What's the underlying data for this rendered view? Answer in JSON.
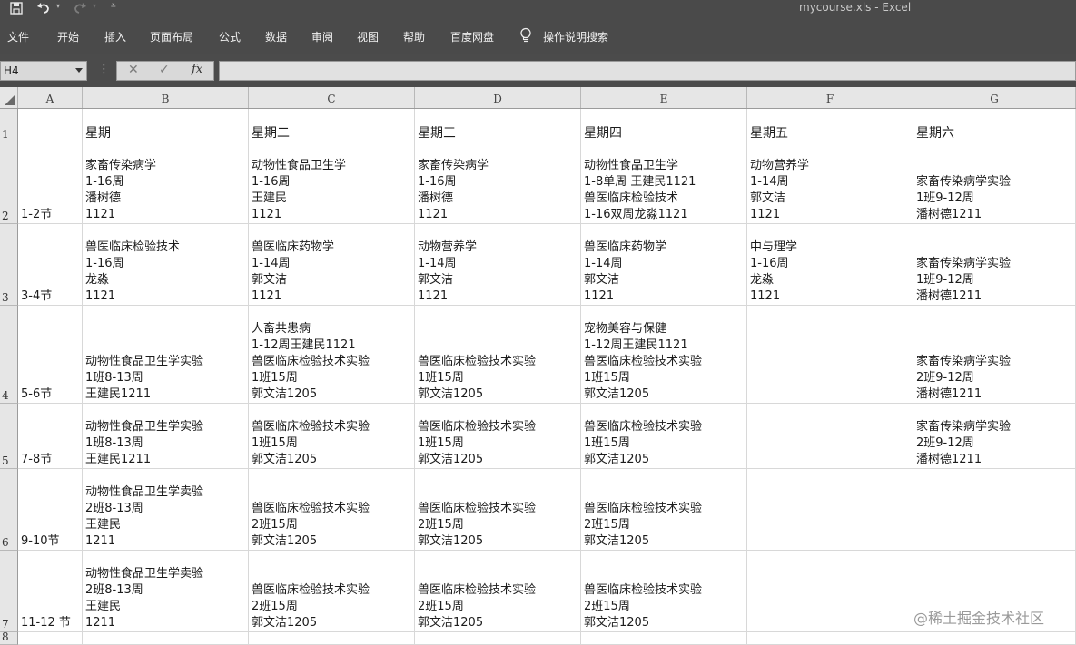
{
  "window": {
    "title": "mycourse.xls  -  Excel"
  },
  "quick_access": {
    "save_icon": "save-icon",
    "undo_icon": "undo-icon",
    "redo_icon": "redo-icon",
    "customize_icon": "customize-qat-icon"
  },
  "ribbon": {
    "tabs": [
      "文件",
      "开始",
      "插入",
      "页面布局",
      "公式",
      "数据",
      "审阅",
      "视图",
      "帮助",
      "百度网盘"
    ],
    "tell_me": "操作说明搜索",
    "tell_me_icon": "lightbulb-icon"
  },
  "formula_bar": {
    "name_box": "H4",
    "cancel_glyph": "✕",
    "enter_glyph": "✓",
    "fx_glyph": "fx",
    "formula": ""
  },
  "sheet": {
    "columns": [
      "A",
      "B",
      "C",
      "D",
      "E",
      "F",
      "G"
    ],
    "rows": [
      {
        "num": "1",
        "cells": [
          "",
          "星期",
          "星期二",
          "星期三",
          "星期四",
          "星期五",
          "星期六"
        ]
      },
      {
        "num": "2",
        "cells": [
          "1-2节",
          "家畜传染病学\n1-16周\n潘树德\n1121",
          "动物性食品卫生学\n1-16周\n王建民\n1121",
          "家畜传染病学\n1-16周\n潘树德\n1121",
          "动物性食品卫生学\n1-8单周 王建民1121\n兽医临床检验技术\n1-16双周龙淼1121",
          "动物营养学\n1-14周\n郭文洁\n1121",
          "家畜传染病学实验\n1班9-12周\n潘树德1211"
        ]
      },
      {
        "num": "3",
        "cells": [
          "3-4节",
          "兽医临床检验技术\n1-16周\n龙淼\n1121",
          "兽医临床药物学\n1-14周\n郭文洁\n1121",
          "动物营养学\n1-14周\n郭文洁\n1121",
          "兽医临床药物学\n1-14周\n郭文洁\n1121",
          "中与理学\n1-16周\n龙淼\n1121",
          "家畜传染病学实验\n1班9-12周\n潘树德1211"
        ]
      },
      {
        "num": "4",
        "cells": [
          "5-6节",
          "动物性食品卫生学实验\n1班8-13周\n王建民1211",
          "人畜共患病\n1-12周王建民1121\n兽医临床检验技术实验\n1班15周\n郭文洁1205",
          "兽医临床检验技术实验\n1班15周\n郭文洁1205",
          "宠物美容与保健\n1-12周王建民1121\n兽医临床检验技术实验\n1班15周\n郭文洁1205",
          "",
          "家畜传染病学实验\n2班9-12周\n潘树德1211"
        ]
      },
      {
        "num": "5",
        "cells": [
          "7-8节",
          "动物性食品卫生学实验\n1班8-13周\n王建民1211",
          "兽医临床检验技术实验\n1班15周\n郭文洁1205",
          "兽医临床检验技术实验\n1班15周\n郭文洁1205",
          "兽医临床检验技术实验\n1班15周\n郭文洁1205",
          "",
          "家畜传染病学实验\n2班9-12周\n潘树德1211"
        ]
      },
      {
        "num": "6",
        "cells": [
          "9-10节",
          "动物性食品卫生学卖验\n2班8-13周\n王建民\n1211",
          "兽医临床检验技术实验\n2班15周\n郭文洁1205",
          "兽医临床检验技术实验\n2班15周\n郭文洁1205",
          "兽医临床检验技术实验\n2班15周\n郭文洁1205",
          "",
          ""
        ]
      },
      {
        "num": "7",
        "cells": [
          "11-12 节",
          "动物性食品卫生学卖验\n2班8-13周\n王建民\n1211",
          "兽医临床检验技术实验\n2班15周\n郭文洁1205",
          "兽医临床检验技术实验\n2班15周\n郭文洁1205",
          "兽医临床检验技术实验\n2班15周\n郭文洁1205",
          "",
          ""
        ]
      },
      {
        "num": "8",
        "cells": [
          "",
          "",
          "",
          "",
          "",
          "",
          ""
        ]
      }
    ]
  },
  "watermark": "@稀土掘金技术社区",
  "colors": {
    "titlebar": "#4a4a4a",
    "header_bg": "#e6e6e6",
    "gridline": "#d8d8d8"
  }
}
